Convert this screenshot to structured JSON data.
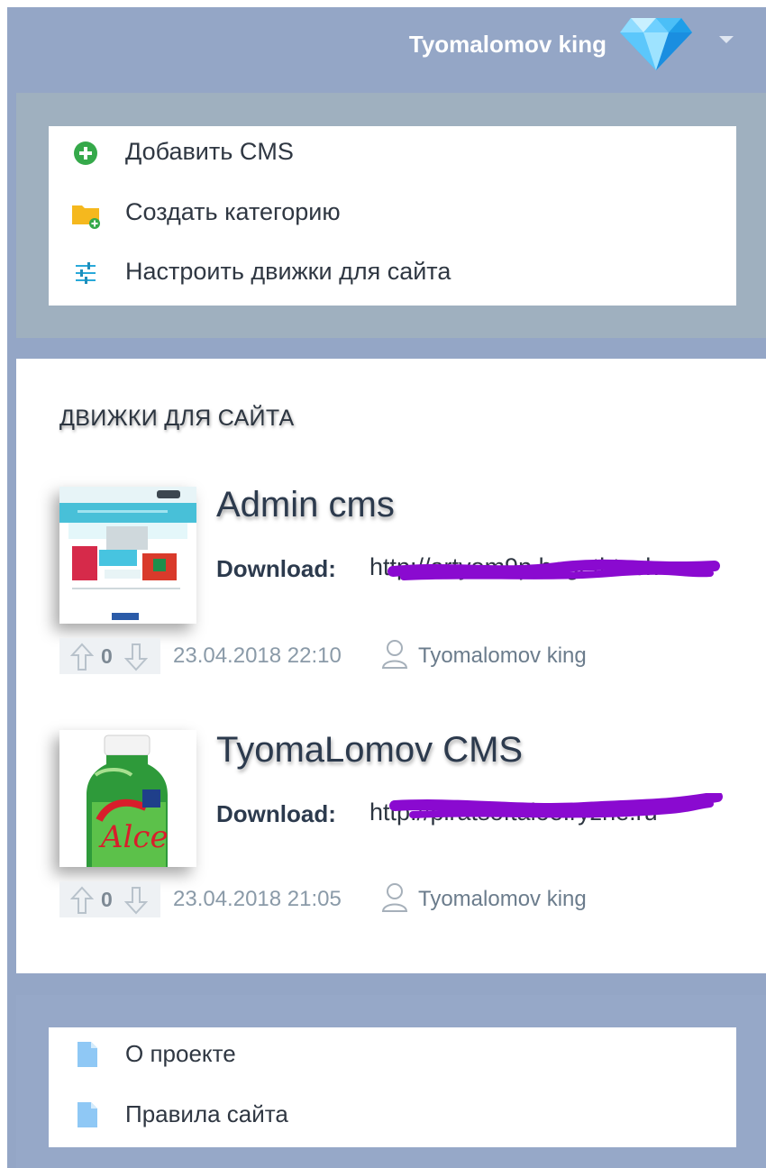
{
  "header": {
    "user_name": "Tyomalomov king",
    "avatar_icon": "diamond-icon",
    "menu_icon": "chevron-down-icon"
  },
  "actions": [
    {
      "label": "Добавить CMS",
      "icon": "add-circle-icon"
    },
    {
      "label": "Создать категорию",
      "icon": "folder-add-icon"
    },
    {
      "label": "Настроить движки для сайта",
      "icon": "sliders-icon"
    }
  ],
  "section": {
    "title": "ДВИЖКИ ДЛЯ САЙТА"
  },
  "posts": [
    {
      "title": "Admin cms",
      "download_label": "Download:",
      "download_url": "http://artyom9p.begethtech",
      "votes": "0",
      "date": "23.04.2018 22:10",
      "author": "Tyomalomov king"
    },
    {
      "title": "TyomaLomov CMS",
      "download_label": "Download:",
      "download_url": "http://piratsoftaloe.ryzhe.ru",
      "votes": "0",
      "date": "23.04.2018 21:05",
      "author": "Tyomalomov king"
    }
  ],
  "footer": [
    {
      "label": "О проекте",
      "icon": "document-icon"
    },
    {
      "label": "Правила сайта",
      "icon": "document-icon"
    }
  ],
  "colors": {
    "frame": "#94a6c6",
    "panel": "#9fb0bf",
    "title_text": "#2c3a4d",
    "meta_text": "#8a9aa8",
    "scribble": "#8a0ad0"
  }
}
